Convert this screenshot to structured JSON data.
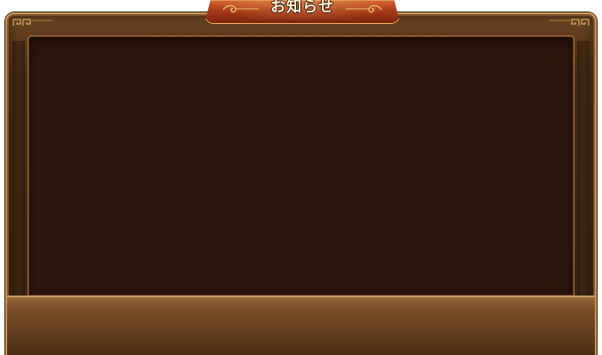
{
  "dialog": {
    "title": "お知らせ"
  },
  "colors": {
    "frame_border": "#c99a57",
    "frame_fill": "#4a2c14",
    "content_background": "#2c160b",
    "title_tab": "#a83a18",
    "title_text": "#fff6d8",
    "footer_band": "#7a4e28"
  }
}
